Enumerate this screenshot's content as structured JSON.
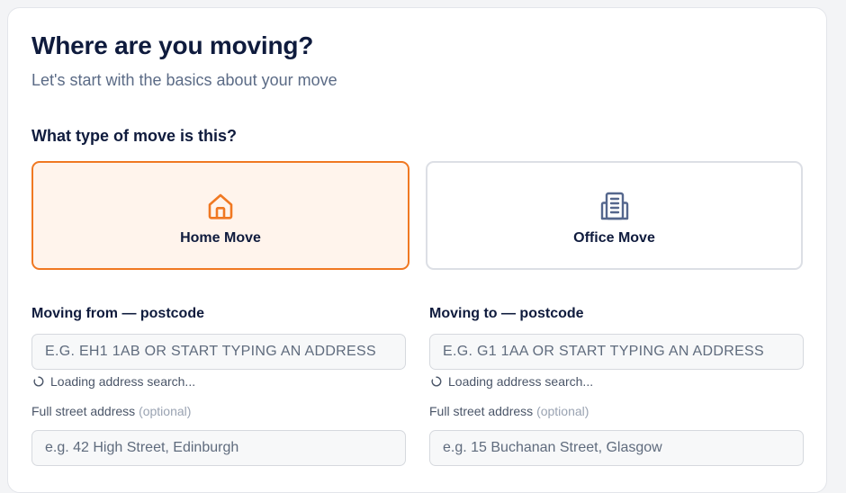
{
  "header": {
    "title": "Where are you moving?",
    "subtitle": "Let's start with the basics about your move"
  },
  "move_type": {
    "question": "What type of move is this?",
    "options": [
      {
        "label": "Home Move",
        "icon": "house-icon",
        "selected": true
      },
      {
        "label": "Office Move",
        "icon": "office-building-icon",
        "selected": false
      }
    ]
  },
  "from": {
    "label": "Moving from — postcode",
    "postcode_placeholder": "E.G. EH1 1AB OR START TYPING AN ADDRESS",
    "loading_text": "Loading address search...",
    "street_label": "Full street address",
    "street_optional": "(optional)",
    "street_placeholder": "e.g. 42 High Street, Edinburgh"
  },
  "to": {
    "label": "Moving to — postcode",
    "postcode_placeholder": "E.G. G1 1AA OR START TYPING AN ADDRESS",
    "loading_text": "Loading address search...",
    "street_label": "Full street address",
    "street_optional": "(optional)",
    "street_placeholder": "e.g. 15 Buchanan Street, Glasgow"
  },
  "colors": {
    "accent": "#f07822",
    "accent_bg": "#fff4ec",
    "office_icon": "#55678d",
    "text_dark": "#0f1b3d"
  }
}
